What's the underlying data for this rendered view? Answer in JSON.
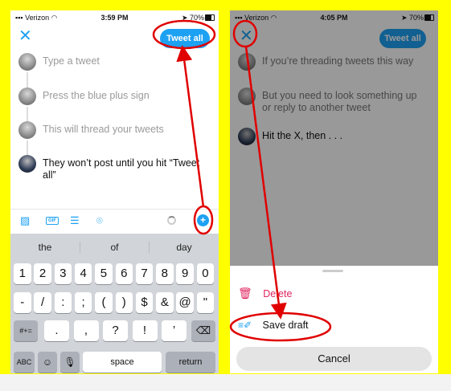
{
  "left": {
    "status": {
      "carrier": "Verizon",
      "time": "3:59 PM",
      "battery": "70%"
    },
    "tweet_all": "Tweet all",
    "tweets": [
      {
        "text": "Type a tweet"
      },
      {
        "text": "Press the blue plus sign"
      },
      {
        "text": "This will thread your tweets"
      },
      {
        "text": "They won’t post until you hit “Tweet all”"
      }
    ],
    "toolbar": {
      "gif": "GIF"
    },
    "keyboard": {
      "suggestions": [
        "the",
        "of",
        "day"
      ],
      "row1": [
        "1",
        "2",
        "3",
        "4",
        "5",
        "6",
        "7",
        "8",
        "9",
        "0"
      ],
      "row2": [
        "-",
        "/",
        ":",
        ";",
        "(",
        ")",
        "$",
        "&",
        "@",
        "\""
      ],
      "row3_left": "#+=",
      "row3": [
        ".",
        ",",
        "?",
        "!",
        "’"
      ],
      "abc": "ABC",
      "space": "space",
      "return": "return"
    }
  },
  "right": {
    "status": {
      "carrier": "Verizon",
      "time": "4:05 PM",
      "battery": "70%"
    },
    "tweet_all": "Tweet all",
    "tweets": [
      {
        "text": "If you’re threading tweets this way"
      },
      {
        "text": "But you need to look something up or reply to another tweet"
      },
      {
        "text": "Hit the X, then . . ."
      }
    ],
    "sheet": {
      "delete": "Delete",
      "save_draft": "Save draft",
      "cancel": "Cancel"
    }
  },
  "colors": {
    "accent": "#1da1f2",
    "annotation": "#e00000",
    "background": "#ffff00",
    "delete": "#e0245e"
  }
}
